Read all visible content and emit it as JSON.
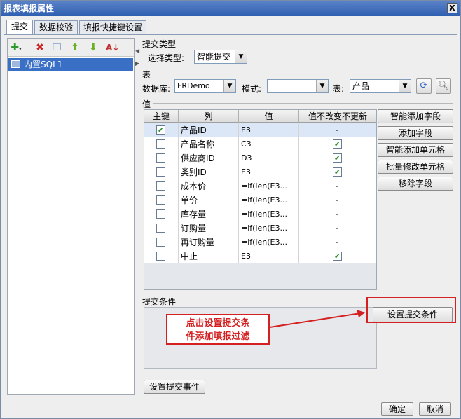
{
  "window": {
    "title": "报表填报属性",
    "close_glyph": "X"
  },
  "tabs": [
    "提交",
    "数据校验",
    "填报快捷键设置"
  ],
  "left": {
    "toolbar_icons": [
      "add-icon",
      "delete-icon",
      "copy-icon",
      "move-up-icon",
      "move-down-icon",
      "sort-icon"
    ],
    "tree_item": "内置SQL1"
  },
  "submit_type": {
    "section": "提交类型",
    "label": "选择类型:",
    "value": "智能提交"
  },
  "table_section": {
    "section": "表",
    "db_label": "数据库:",
    "db_value": "FRDemo",
    "mode_label": "模式:",
    "mode_value": "",
    "table_label": "表:",
    "table_value": "产品"
  },
  "values": {
    "section": "值",
    "headers": [
      "主键",
      "列",
      "值",
      "值不改变不更新"
    ],
    "rows": [
      {
        "key": true,
        "col": "产品ID",
        "val": "E3",
        "nochange": "-"
      },
      {
        "key": false,
        "col": "产品名称",
        "val": "C3",
        "nochange": "check"
      },
      {
        "key": false,
        "col": "供应商ID",
        "val": "D3",
        "nochange": "check"
      },
      {
        "key": false,
        "col": "类别ID",
        "val": "E3",
        "nochange": "check"
      },
      {
        "key": false,
        "col": "成本价",
        "val": "=if(len(E3...",
        "nochange": "-"
      },
      {
        "key": false,
        "col": "单价",
        "val": "=if(len(E3...",
        "nochange": "-"
      },
      {
        "key": false,
        "col": "库存量",
        "val": "=if(len(E3...",
        "nochange": "-"
      },
      {
        "key": false,
        "col": "订购量",
        "val": "=if(len(E3...",
        "nochange": "-"
      },
      {
        "key": false,
        "col": "再订购量",
        "val": "=if(len(E3...",
        "nochange": "-"
      },
      {
        "key": false,
        "col": "中止",
        "val": "E3",
        "nochange": "check"
      }
    ],
    "buttons": [
      "智能添加字段",
      "添加字段",
      "智能添加单元格",
      "批量修改单元格",
      "移除字段"
    ]
  },
  "condition": {
    "section": "提交条件",
    "button": "设置提交条件"
  },
  "event_button": "设置提交事件",
  "callout": {
    "line1": "点击设置提交条",
    "line2": "件添加填报过滤",
    "color": "#d42020"
  },
  "footer": {
    "ok": "确定",
    "cancel": "取消"
  }
}
